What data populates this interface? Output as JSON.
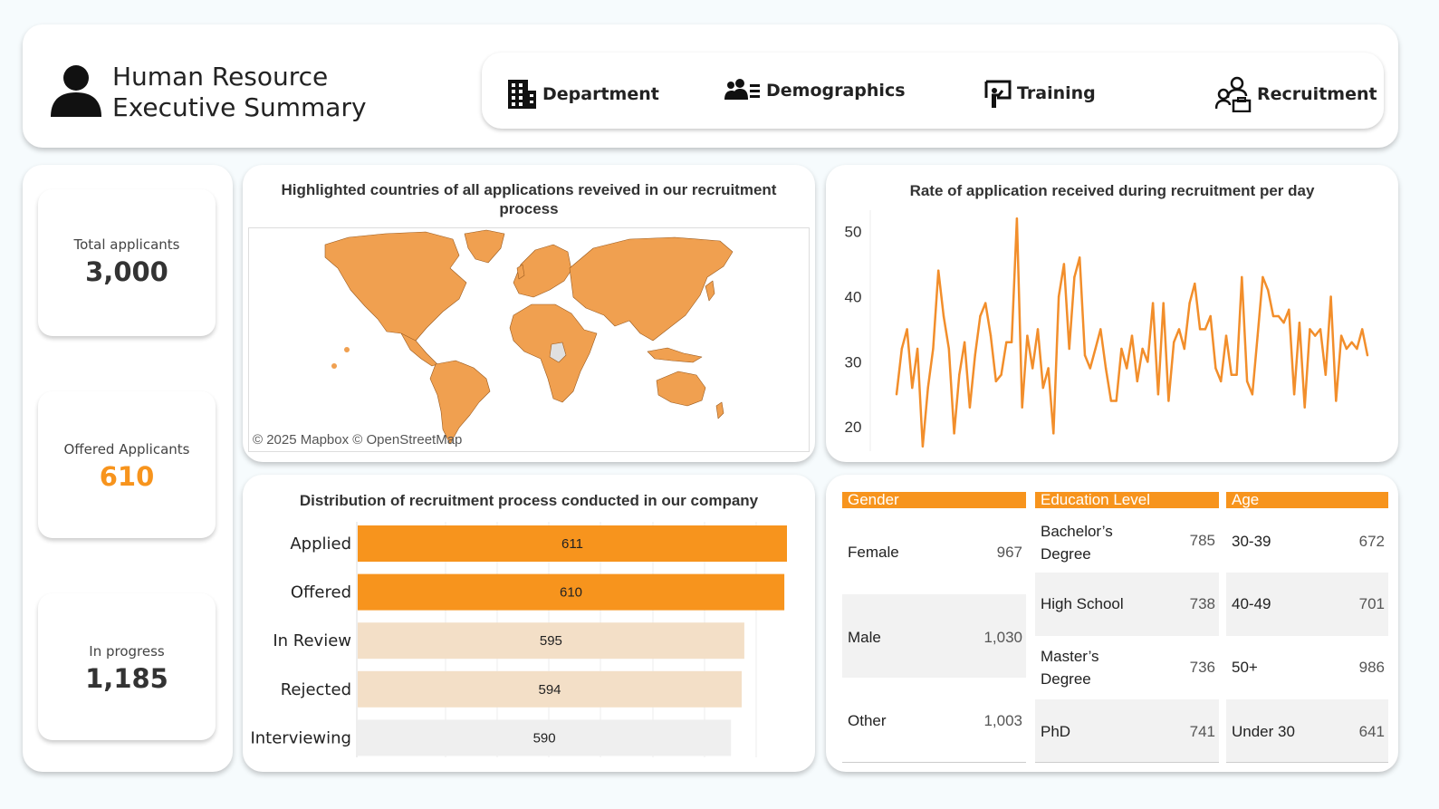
{
  "header": {
    "title_line1": "Human Resource",
    "title_line2": "Executive Summary",
    "nav": [
      {
        "label": "Department",
        "icon": "building-icon"
      },
      {
        "label": "Demographics",
        "icon": "users-icon"
      },
      {
        "label": "Training",
        "icon": "presentation-icon"
      },
      {
        "label": "Recruitment",
        "icon": "recruitment-icon"
      }
    ]
  },
  "kpis": [
    {
      "label": "Total applicants",
      "value": "3,000",
      "color": "#333333"
    },
    {
      "label": "Offered Applicants",
      "value": "610",
      "color": "#f7941d"
    },
    {
      "label": "In progress",
      "value": "1,185",
      "color": "#333333"
    }
  ],
  "map": {
    "title": "Highlighted countries of all applications reveived in our recruitment process",
    "attribution": "© 2025 Mapbox © OpenStreetMap",
    "fill_color": "#f0a050"
  },
  "line_chart": {
    "title": "Rate of application received during recruitment per day",
    "chart_data": {
      "type": "line",
      "ylim": [
        16,
        53
      ],
      "yticks": [
        20,
        30,
        40,
        50
      ],
      "color": "#f28e2b",
      "values": [
        25,
        32,
        35,
        26,
        32,
        17,
        26,
        32,
        44,
        37,
        32,
        19,
        28,
        33,
        23,
        31,
        37,
        39,
        34,
        27,
        28,
        33,
        33,
        52,
        23,
        34,
        29,
        35,
        26,
        29,
        19,
        40,
        45,
        32,
        43,
        46,
        31,
        29,
        32,
        35,
        29,
        24,
        24,
        32,
        29,
        34,
        27,
        32,
        30,
        39,
        25,
        39,
        24,
        33,
        35,
        32,
        39,
        42,
        35,
        35,
        37,
        29,
        27,
        34,
        28,
        28,
        43,
        27,
        25,
        34,
        43,
        41,
        37,
        37,
        36,
        38,
        25,
        36,
        23,
        35,
        34,
        35,
        28,
        40,
        24,
        34,
        32,
        33,
        32,
        35,
        31
      ]
    }
  },
  "bar_chart": {
    "title": "Distribution of recruitment process conducted in our company",
    "chart_data": {
      "type": "bar",
      "categories": [
        "Applied",
        "Offered",
        "In Review",
        "Rejected",
        "Interviewing"
      ],
      "values": [
        611,
        610,
        595,
        594,
        590
      ],
      "colors": [
        "#f7941d",
        "#f7941d",
        "#f3dfc7",
        "#f3dfc7",
        "#efefef"
      ]
    }
  },
  "table": {
    "gender": {
      "header": "Gender",
      "rows": [
        {
          "label": "Female",
          "value": "967"
        },
        {
          "label": "Male",
          "value": "1,030"
        },
        {
          "label": "Other",
          "value": "1,003"
        }
      ]
    },
    "education": {
      "header": "Education Level",
      "rows": [
        {
          "label1": "Bachelor’s",
          "label2": "Degree",
          "value": "785"
        },
        {
          "label1": "High School",
          "label2": "",
          "value": "738"
        },
        {
          "label1": "Master’s",
          "label2": "Degree",
          "value": "736"
        },
        {
          "label1": "PhD",
          "label2": "",
          "value": "741"
        }
      ]
    },
    "age": {
      "header": "Age",
      "rows": [
        {
          "label": "30-39",
          "value": "672"
        },
        {
          "label": "40-49",
          "value": "701"
        },
        {
          "label": "50+",
          "value": "986"
        },
        {
          "label": "Under 30",
          "value": "641"
        }
      ]
    }
  }
}
